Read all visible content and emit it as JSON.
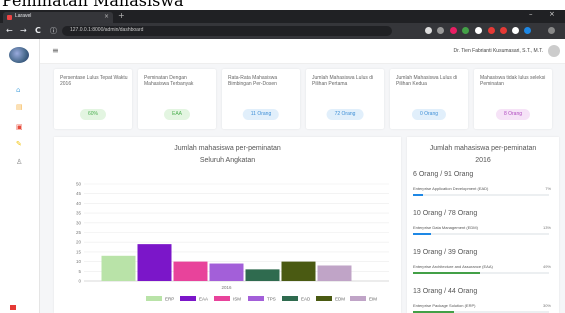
{
  "caption": "Peminatan Mahasiswa",
  "browser": {
    "tab_title": "Laravel",
    "close_glyph": "×",
    "newtab_glyph": "+",
    "url": "127.0.0.1:8000/admin/dashboard",
    "min_glyph": "–",
    "winclose_glyph": "×",
    "back_glyph": "←",
    "forward_glyph": "→",
    "reload_glyph": "C",
    "info_glyph": "ⓘ"
  },
  "topbar": {
    "menu_glyph": "≡",
    "user_name": "Dr. Tien Fabrianti Kusumasari, S.T., M.T."
  },
  "sidebar_icons": [
    {
      "name": "home-icon",
      "glyph": "⌂",
      "color": "#5dade2"
    },
    {
      "name": "list-icon",
      "glyph": "▤",
      "color": "#f5b041"
    },
    {
      "name": "book-icon",
      "glyph": "▣",
      "color": "#e74c3c"
    },
    {
      "name": "pen-icon",
      "glyph": "✎",
      "color": "#f1c40f"
    },
    {
      "name": "user-icon",
      "glyph": "♙",
      "color": "#888888"
    }
  ],
  "stats": [
    {
      "label": "Persentase Lulus Tepat Waktu 2016",
      "value": "60%",
      "bg": "#e3f5e1",
      "fg": "#4caf50"
    },
    {
      "label": "Peminatan Dengan Mahasiswa Terbanyak",
      "value": "EAA",
      "bg": "#e3f5e1",
      "fg": "#4caf50"
    },
    {
      "label": "Rata-Rata Mahasiswa Bimbingan Per-Dosen",
      "value": "11 Orang",
      "bg": "#e1effb",
      "fg": "#3f8fd6"
    },
    {
      "label": "Jumlah Mahasiswa Lulus di Pilihan Pertama",
      "value": "72 Orang",
      "bg": "#e1effb",
      "fg": "#3f8fd6"
    },
    {
      "label": "Jumlah Mahasiswa Lulus di Pilihan Kedua",
      "value": "0 Orang",
      "bg": "#e1effb",
      "fg": "#3f8fd6"
    },
    {
      "label": "Mahasiswa tidak lulus seleksi Peminatan",
      "value": "8 Orang",
      "bg": "#f6e3f7",
      "fg": "#b04bc0"
    }
  ],
  "chart_panel": {
    "title_line1": "Jumlah mahasiswa per-peminatan",
    "title_line2": "Seluruh Angkatan"
  },
  "chart_data": {
    "type": "bar",
    "x": [
      "2016"
    ],
    "yticks": [
      "0",
      "5",
      "10",
      "15",
      "20",
      "25",
      "30",
      "35",
      "40",
      "45",
      "50"
    ],
    "ylim": [
      0,
      50
    ],
    "grid": true,
    "legend_position": "bottom",
    "series": [
      {
        "name": "ERP",
        "values": [
          13
        ],
        "color": "#b9e3a8"
      },
      {
        "name": "EAA",
        "values": [
          19
        ],
        "color": "#7b16c9"
      },
      {
        "name": "ISM",
        "values": [
          10
        ],
        "color": "#e8439b"
      },
      {
        "name": "TPS",
        "values": [
          9
        ],
        "color": "#a35fd9"
      },
      {
        "name": "EAD",
        "values": [
          6
        ],
        "color": "#2f6b4f"
      },
      {
        "name": "EDM",
        "values": [
          10
        ],
        "color": "#4a5a12"
      },
      {
        "name": "EIM",
        "values": [
          8
        ],
        "color": "#c0a4c7"
      }
    ]
  },
  "progress_panel": {
    "title_line1": "Jumlah mahasiswa per-peminatan",
    "title_line2": "2016",
    "items": [
      {
        "count": "6 Orang / 91 Orang",
        "name": "Enterprise Application Development (EAD)",
        "percent": "7%",
        "fraction": 0.07,
        "color": "#1e88e5"
      },
      {
        "count": "10 Orang / 78 Orang",
        "name": "Enterprise Data Management (EDM)",
        "percent": "13%",
        "fraction": 0.13,
        "color": "#1e88e5"
      },
      {
        "count": "19 Orang / 39 Orang",
        "name": "Enterprise Architecture and Assurance (EAA)",
        "percent": "49%",
        "fraction": 0.49,
        "color": "#43a047"
      },
      {
        "count": "13 Orang / 44 Orang",
        "name": "Enterprise Package Solution (ERP)",
        "percent": "30%",
        "fraction": 0.3,
        "color": "#43a047"
      }
    ]
  }
}
